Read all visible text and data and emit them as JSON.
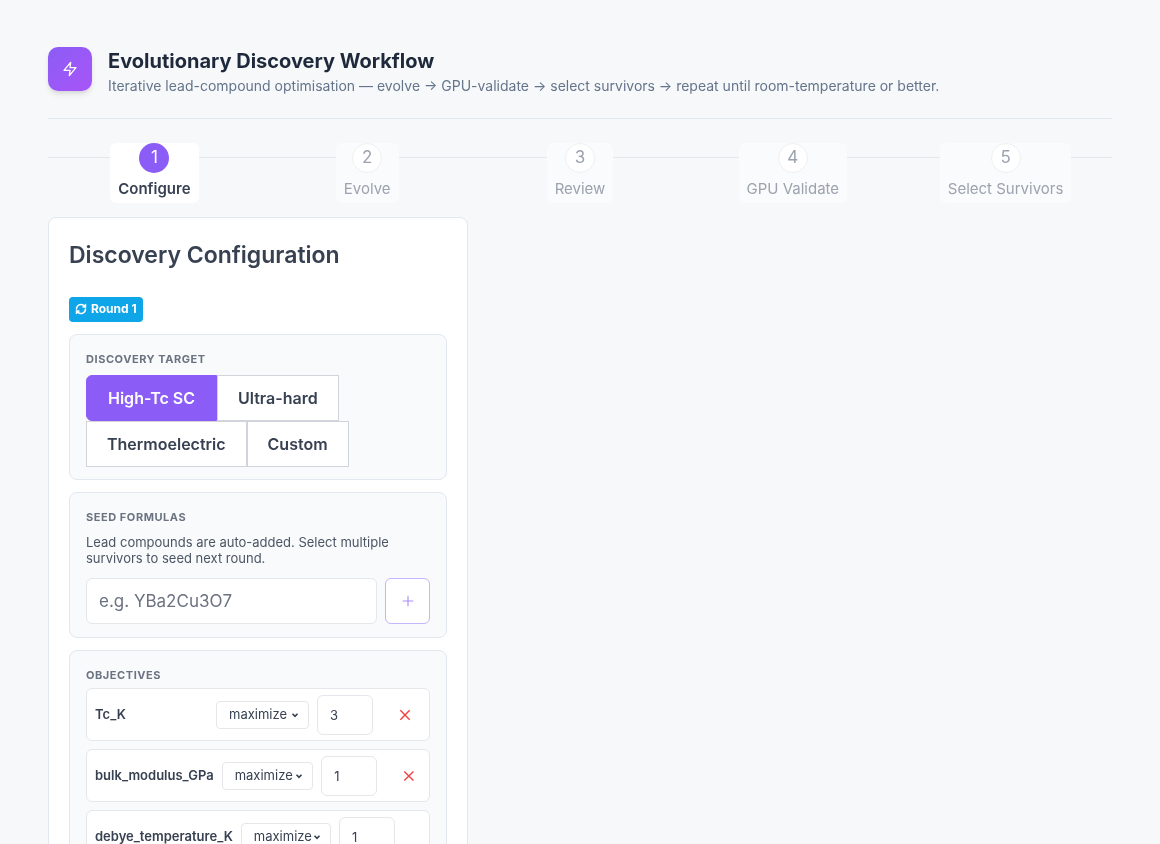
{
  "header": {
    "title": "Evolutionary Discovery Workflow",
    "subtitle": "Iterative lead-compound optimisation — evolve → GPU-validate → select survivors → repeat until room-temperature or better."
  },
  "steps": [
    {
      "number": "1",
      "label": "Configure",
      "selected": true
    },
    {
      "number": "2",
      "label": "Evolve",
      "selected": false
    },
    {
      "number": "3",
      "label": "Review",
      "selected": false
    },
    {
      "number": "4",
      "label": "GPU Validate",
      "selected": false
    },
    {
      "number": "5",
      "label": "Select Survivors",
      "selected": false
    }
  ],
  "panel": {
    "title": "Discovery Configuration",
    "round_badge": "Round 1",
    "target": {
      "heading": "DISCOVERY TARGET",
      "options": [
        {
          "label": "High-Tc SC",
          "selected": true
        },
        {
          "label": "Ultra-hard",
          "selected": false
        },
        {
          "label": "Thermoelectric",
          "selected": false
        },
        {
          "label": "Custom",
          "selected": false
        }
      ]
    },
    "seeds": {
      "heading": "SEED FORMULAS",
      "hint": "Lead compounds are auto-added. Select multiple survivors to seed next round.",
      "placeholder": "e.g. YBa2Cu3O7"
    },
    "objectives": {
      "heading": "OBJECTIVES",
      "rows": [
        {
          "name": "Tc_K",
          "direction": "maximize",
          "weight": "3"
        },
        {
          "name": "bulk_modulus_GPa",
          "direction": "maximize",
          "weight": "1"
        },
        {
          "name": "debye_temperature_K",
          "direction": "maximize",
          "weight": "1"
        }
      ]
    }
  }
}
